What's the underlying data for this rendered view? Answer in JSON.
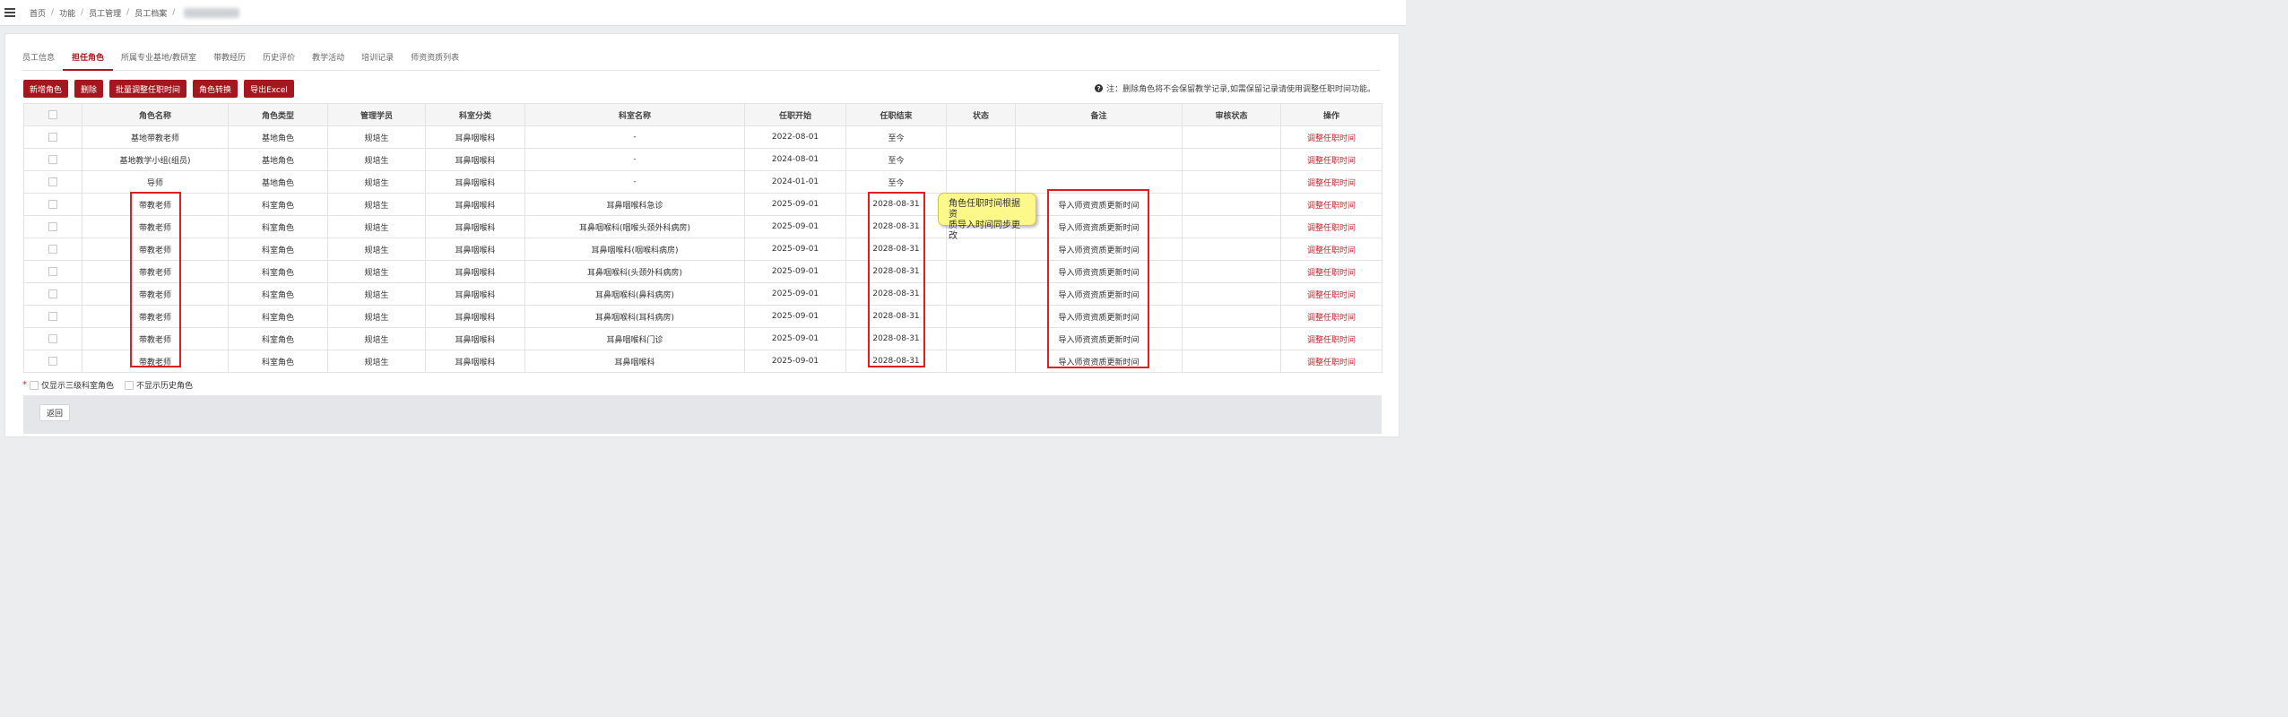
{
  "breadcrumb": [
    "首页",
    "功能",
    "员工管理",
    "员工档案"
  ],
  "tabs": [
    "员工信息",
    "担任角色",
    "所属专业基地/教研室",
    "带教经历",
    "历史评价",
    "教学活动",
    "培训记录",
    "师资资质列表"
  ],
  "toolbar": {
    "add_role": "新增角色",
    "delete": "删除",
    "batch_adjust": "批量调整任职时间",
    "switch_role": "角色转换",
    "export": "导出Excel"
  },
  "notice": "注：删除角色将不会保留教学记录,如需保留记录请使用调整任职时间功能。",
  "columns": [
    "角色名称",
    "角色类型",
    "管理学员",
    "科室分类",
    "科室名称",
    "任职开始",
    "任职结束",
    "状态",
    "备注",
    "审核状态",
    "操作"
  ],
  "rows": [
    {
      "name": "基地带教老师",
      "type": "基地角色",
      "student": "规培生",
      "category": "耳鼻咽喉科",
      "dept": "-",
      "start": "2022-08-01",
      "end": "至今",
      "status": "",
      "remark": "",
      "audit": "",
      "action": "调整任职时间"
    },
    {
      "name": "基地教学小组(组员)",
      "type": "基地角色",
      "student": "规培生",
      "category": "耳鼻咽喉科",
      "dept": "-",
      "start": "2024-08-01",
      "end": "至今",
      "status": "",
      "remark": "",
      "audit": "",
      "action": "调整任职时间"
    },
    {
      "name": "导师",
      "type": "基地角色",
      "student": "规培生",
      "category": "耳鼻咽喉科",
      "dept": "-",
      "start": "2024-01-01",
      "end": "至今",
      "status": "",
      "remark": "",
      "audit": "",
      "action": "调整任职时间"
    },
    {
      "name": "带教老师",
      "type": "科室角色",
      "student": "规培生",
      "category": "耳鼻咽喉科",
      "dept": "耳鼻咽喉科急诊",
      "start": "2025-09-01",
      "end": "2028-08-31",
      "status": "",
      "remark": "导入师资资质更新时间",
      "audit": "",
      "action": "调整任职时间"
    },
    {
      "name": "带教老师",
      "type": "科室角色",
      "student": "规培生",
      "category": "耳鼻咽喉科",
      "dept": "耳鼻咽喉科(咽喉头颈外科病房)",
      "start": "2025-09-01",
      "end": "2028-08-31",
      "status": "",
      "remark": "导入师资资质更新时间",
      "audit": "",
      "action": "调整任职时间"
    },
    {
      "name": "带教老师",
      "type": "科室角色",
      "student": "规培生",
      "category": "耳鼻咽喉科",
      "dept": "耳鼻咽喉科(咽喉科病房)",
      "start": "2025-09-01",
      "end": "2028-08-31",
      "status": "",
      "remark": "导入师资资质更新时间",
      "audit": "",
      "action": "调整任职时间"
    },
    {
      "name": "带教老师",
      "type": "科室角色",
      "student": "规培生",
      "category": "耳鼻咽喉科",
      "dept": "耳鼻咽喉科(头颈外科病房)",
      "start": "2025-09-01",
      "end": "2028-08-31",
      "status": "",
      "remark": "导入师资资质更新时间",
      "audit": "",
      "action": "调整任职时间"
    },
    {
      "name": "带教老师",
      "type": "科室角色",
      "student": "规培生",
      "category": "耳鼻咽喉科",
      "dept": "耳鼻咽喉科(鼻科病房)",
      "start": "2025-09-01",
      "end": "2028-08-31",
      "status": "",
      "remark": "导入师资资质更新时间",
      "audit": "",
      "action": "调整任职时间"
    },
    {
      "name": "带教老师",
      "type": "科室角色",
      "student": "规培生",
      "category": "耳鼻咽喉科",
      "dept": "耳鼻咽喉科(耳科病房)",
      "start": "2025-09-01",
      "end": "2028-08-31",
      "status": "",
      "remark": "导入师资资质更新时间",
      "audit": "",
      "action": "调整任职时间"
    },
    {
      "name": "带教老师",
      "type": "科室角色",
      "student": "规培生",
      "category": "耳鼻咽喉科",
      "dept": "耳鼻咽喉科门诊",
      "start": "2025-09-01",
      "end": "2028-08-31",
      "status": "",
      "remark": "导入师资资质更新时间",
      "audit": "",
      "action": "调整任职时间"
    },
    {
      "name": "带教老师",
      "type": "科室角色",
      "student": "规培生",
      "category": "耳鼻咽喉科",
      "dept": "耳鼻咽喉科",
      "start": "2025-09-01",
      "end": "2028-08-31",
      "status": "",
      "remark": "导入师资资质更新时间",
      "audit": "",
      "action": "调整任职时间"
    }
  ],
  "callout": {
    "line1": "角色任职时间根据资",
    "line2": "质导入时间同步更改"
  },
  "filters": {
    "only_level3": "仅显示三级科室角色",
    "hide_history": "不显示历史角色"
  },
  "footer": {
    "back": "返回"
  },
  "colors": {
    "accent": "#a5171f",
    "highlight": "#e31b23",
    "callout_bg": "#fdf88a"
  }
}
